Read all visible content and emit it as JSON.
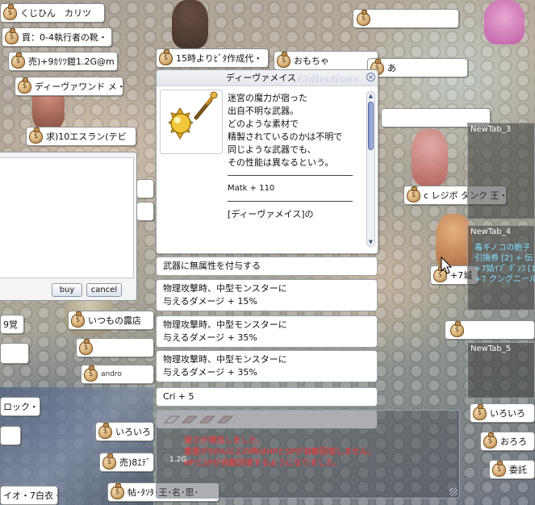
{
  "shops_left": [
    {
      "label": "くじひん　カリツ"
    },
    {
      "label": "買：0-4執行者の靴・"
    },
    {
      "label": "売)+9ｶﾘﾂ鎧1.2G@m"
    },
    {
      "label": "ディーヴァワンド メ・"
    },
    {
      "label": "求)10エスラン(テビ"
    },
    {
      "label": "9覚"
    },
    {
      "label": "いつもの露店"
    },
    {
      "label": "ロック・"
    },
    {
      "label": "いろいろ"
    },
    {
      "label": "売)8ｴﾃﾞ"
    },
    {
      "label": "イオ・7白衣・"
    },
    {
      "label": "帖･ﾀｿﾀ･王･名･思･"
    },
    {
      "label": "1.2G"
    }
  ],
  "shops_right": [
    {
      "label": "15時よりﾋﾞﾀ作成代・"
    },
    {
      "label": "おもちゃ"
    },
    {
      "label": "あ"
    },
    {
      "label": "c レジボ タンク 王・"
    },
    {
      "label": "+7城"
    },
    {
      "label": "いろいろ"
    },
    {
      "label": "おろろ"
    },
    {
      "label": "委託"
    }
  ],
  "item": {
    "name": "ディーヴァメイス",
    "watermark": "Collections",
    "description": [
      "迷宮の魔力が宿った",
      "出自不明な武器。",
      "どのような素材で",
      "精製されているのかは不明で",
      "同じような武器でも、",
      "その性能は異なるという。"
    ],
    "stat": "Matk + 110",
    "footer": "[ディーヴァメイス]の"
  },
  "options": [
    {
      "lines": [
        "武器に無属性を付与する"
      ]
    },
    {
      "lines": [
        "物理攻撃時、中型モンスターに",
        "与えるダメージ + 15%"
      ]
    },
    {
      "lines": [
        "物理攻撃時、中型モンスターに",
        "与えるダメージ + 35%"
      ]
    },
    {
      "lines": [
        "物理攻撃時、中型モンスターに",
        "与えるダメージ + 35%"
      ]
    },
    {
      "lines": [
        "Cri + 5"
      ]
    }
  ],
  "buy_window": {
    "buy_label": "buy",
    "cancel_label": "cancel"
  },
  "tabs": [
    {
      "title": "NewTab_3"
    },
    {
      "title": "NewTab_4"
    },
    {
      "title": "NewTab_5"
    }
  ],
  "tab4_lines": [
    "毒キノコの胞子",
    "引換券 [2] + 伝",
    "+7姑ｲﾌﾞ ﾀﾞﾝﾌ [1]",
    "+7 クングニール"
  ],
  "chat": {
    "lines": [
      {
        "text": "速さが増加しました。",
        "kind": "sys"
      },
      {
        "text": "重量が50%以上の時はHPとSPが自動回復しません。",
        "kind": "sys"
      },
      {
        "text": "HPとSPが自動回復するようになりました。",
        "kind": "sys"
      }
    ]
  },
  "misc": {
    "name_tag": "andro"
  }
}
